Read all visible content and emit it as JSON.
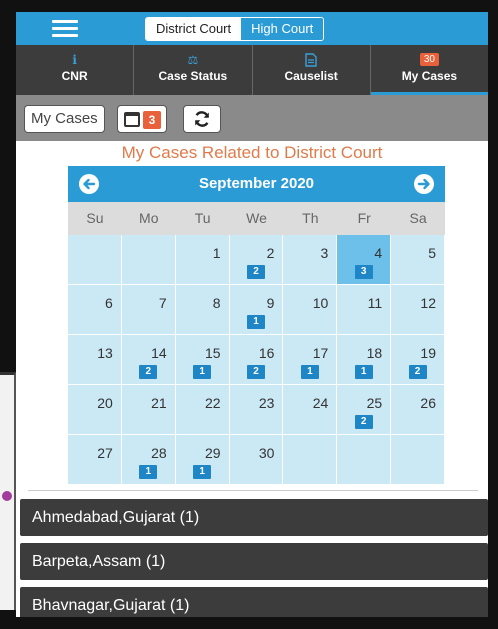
{
  "topbar": {
    "court_toggle": [
      {
        "label": "District Court",
        "active": true
      },
      {
        "label": "High Court",
        "active": false
      }
    ]
  },
  "tabs": [
    {
      "label": "CNR",
      "icon": "info-icon",
      "icon_text": "i"
    },
    {
      "label": "Case Status",
      "icon": "scales-icon",
      "icon_text": "⚖"
    },
    {
      "label": "Causelist",
      "icon": "document-icon",
      "icon_text": "🗎"
    },
    {
      "label": "My Cases",
      "badge": "30",
      "active": true
    }
  ],
  "toolbar": {
    "my_cases_label": "My Cases",
    "calendar_badge": "3",
    "refresh_icon": "refresh-icon"
  },
  "page_title": "My Cases Related to District Court",
  "calendar": {
    "month_title": "September 2020",
    "weekdays": [
      "Su",
      "Mo",
      "Tu",
      "We",
      "Th",
      "Fr",
      "Sa"
    ],
    "weeks": [
      [
        {
          "day": ""
        },
        {
          "day": ""
        },
        {
          "day": "1"
        },
        {
          "day": "2",
          "count": "2"
        },
        {
          "day": "3"
        },
        {
          "day": "4",
          "count": "3",
          "selected": true
        },
        {
          "day": "5"
        }
      ],
      [
        {
          "day": "6"
        },
        {
          "day": "7"
        },
        {
          "day": "8"
        },
        {
          "day": "9",
          "count": "1"
        },
        {
          "day": "10"
        },
        {
          "day": "11"
        },
        {
          "day": "12"
        }
      ],
      [
        {
          "day": "13"
        },
        {
          "day": "14",
          "count": "2"
        },
        {
          "day": "15",
          "count": "1"
        },
        {
          "day": "16",
          "count": "2"
        },
        {
          "day": "17",
          "count": "1"
        },
        {
          "day": "18",
          "count": "1"
        },
        {
          "day": "19",
          "count": "2"
        }
      ],
      [
        {
          "day": "20"
        },
        {
          "day": "21"
        },
        {
          "day": "22"
        },
        {
          "day": "23"
        },
        {
          "day": "24"
        },
        {
          "day": "25",
          "count": "2"
        },
        {
          "day": "26"
        }
      ],
      [
        {
          "day": "27"
        },
        {
          "day": "28",
          "count": "1"
        },
        {
          "day": "29",
          "count": "1"
        },
        {
          "day": "30"
        },
        {
          "day": ""
        },
        {
          "day": ""
        },
        {
          "day": ""
        }
      ]
    ]
  },
  "locations": [
    {
      "label": "Ahmedabad,Gujarat (1)"
    },
    {
      "label": "Barpeta,Assam (1)"
    },
    {
      "label": "Bhavnagar,Gujarat (1)"
    }
  ],
  "colors": {
    "accent": "#2b9bd6",
    "dark_bar": "#3c3c3c",
    "toolbar": "#8a8a8a",
    "title_orange": "#e07a4a",
    "badge_orange": "#e8613a",
    "calendar_cell": "#cbe8f5",
    "selected_cell": "#6dc0ea"
  }
}
